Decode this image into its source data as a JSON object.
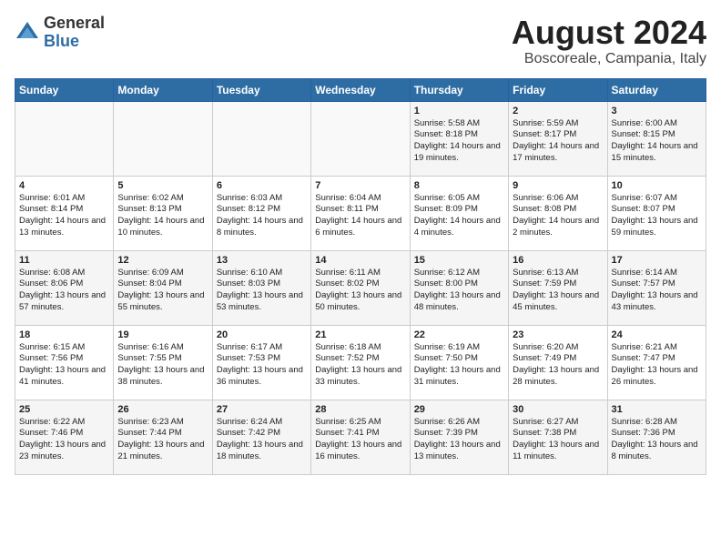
{
  "header": {
    "logo_general": "General",
    "logo_blue": "Blue",
    "month_year": "August 2024",
    "location": "Boscoreale, Campania, Italy"
  },
  "weekdays": [
    "Sunday",
    "Monday",
    "Tuesday",
    "Wednesday",
    "Thursday",
    "Friday",
    "Saturday"
  ],
  "weeks": [
    [
      {
        "day": "",
        "info": ""
      },
      {
        "day": "",
        "info": ""
      },
      {
        "day": "",
        "info": ""
      },
      {
        "day": "",
        "info": ""
      },
      {
        "day": "1",
        "info": "Sunrise: 5:58 AM\nSunset: 8:18 PM\nDaylight: 14 hours and 19 minutes."
      },
      {
        "day": "2",
        "info": "Sunrise: 5:59 AM\nSunset: 8:17 PM\nDaylight: 14 hours and 17 minutes."
      },
      {
        "day": "3",
        "info": "Sunrise: 6:00 AM\nSunset: 8:15 PM\nDaylight: 14 hours and 15 minutes."
      }
    ],
    [
      {
        "day": "4",
        "info": "Sunrise: 6:01 AM\nSunset: 8:14 PM\nDaylight: 14 hours and 13 minutes."
      },
      {
        "day": "5",
        "info": "Sunrise: 6:02 AM\nSunset: 8:13 PM\nDaylight: 14 hours and 10 minutes."
      },
      {
        "day": "6",
        "info": "Sunrise: 6:03 AM\nSunset: 8:12 PM\nDaylight: 14 hours and 8 minutes."
      },
      {
        "day": "7",
        "info": "Sunrise: 6:04 AM\nSunset: 8:11 PM\nDaylight: 14 hours and 6 minutes."
      },
      {
        "day": "8",
        "info": "Sunrise: 6:05 AM\nSunset: 8:09 PM\nDaylight: 14 hours and 4 minutes."
      },
      {
        "day": "9",
        "info": "Sunrise: 6:06 AM\nSunset: 8:08 PM\nDaylight: 14 hours and 2 minutes."
      },
      {
        "day": "10",
        "info": "Sunrise: 6:07 AM\nSunset: 8:07 PM\nDaylight: 13 hours and 59 minutes."
      }
    ],
    [
      {
        "day": "11",
        "info": "Sunrise: 6:08 AM\nSunset: 8:06 PM\nDaylight: 13 hours and 57 minutes."
      },
      {
        "day": "12",
        "info": "Sunrise: 6:09 AM\nSunset: 8:04 PM\nDaylight: 13 hours and 55 minutes."
      },
      {
        "day": "13",
        "info": "Sunrise: 6:10 AM\nSunset: 8:03 PM\nDaylight: 13 hours and 53 minutes."
      },
      {
        "day": "14",
        "info": "Sunrise: 6:11 AM\nSunset: 8:02 PM\nDaylight: 13 hours and 50 minutes."
      },
      {
        "day": "15",
        "info": "Sunrise: 6:12 AM\nSunset: 8:00 PM\nDaylight: 13 hours and 48 minutes."
      },
      {
        "day": "16",
        "info": "Sunrise: 6:13 AM\nSunset: 7:59 PM\nDaylight: 13 hours and 45 minutes."
      },
      {
        "day": "17",
        "info": "Sunrise: 6:14 AM\nSunset: 7:57 PM\nDaylight: 13 hours and 43 minutes."
      }
    ],
    [
      {
        "day": "18",
        "info": "Sunrise: 6:15 AM\nSunset: 7:56 PM\nDaylight: 13 hours and 41 minutes."
      },
      {
        "day": "19",
        "info": "Sunrise: 6:16 AM\nSunset: 7:55 PM\nDaylight: 13 hours and 38 minutes."
      },
      {
        "day": "20",
        "info": "Sunrise: 6:17 AM\nSunset: 7:53 PM\nDaylight: 13 hours and 36 minutes."
      },
      {
        "day": "21",
        "info": "Sunrise: 6:18 AM\nSunset: 7:52 PM\nDaylight: 13 hours and 33 minutes."
      },
      {
        "day": "22",
        "info": "Sunrise: 6:19 AM\nSunset: 7:50 PM\nDaylight: 13 hours and 31 minutes."
      },
      {
        "day": "23",
        "info": "Sunrise: 6:20 AM\nSunset: 7:49 PM\nDaylight: 13 hours and 28 minutes."
      },
      {
        "day": "24",
        "info": "Sunrise: 6:21 AM\nSunset: 7:47 PM\nDaylight: 13 hours and 26 minutes."
      }
    ],
    [
      {
        "day": "25",
        "info": "Sunrise: 6:22 AM\nSunset: 7:46 PM\nDaylight: 13 hours and 23 minutes."
      },
      {
        "day": "26",
        "info": "Sunrise: 6:23 AM\nSunset: 7:44 PM\nDaylight: 13 hours and 21 minutes."
      },
      {
        "day": "27",
        "info": "Sunrise: 6:24 AM\nSunset: 7:42 PM\nDaylight: 13 hours and 18 minutes."
      },
      {
        "day": "28",
        "info": "Sunrise: 6:25 AM\nSunset: 7:41 PM\nDaylight: 13 hours and 16 minutes."
      },
      {
        "day": "29",
        "info": "Sunrise: 6:26 AM\nSunset: 7:39 PM\nDaylight: 13 hours and 13 minutes."
      },
      {
        "day": "30",
        "info": "Sunrise: 6:27 AM\nSunset: 7:38 PM\nDaylight: 13 hours and 11 minutes."
      },
      {
        "day": "31",
        "info": "Sunrise: 6:28 AM\nSunset: 7:36 PM\nDaylight: 13 hours and 8 minutes."
      }
    ]
  ]
}
